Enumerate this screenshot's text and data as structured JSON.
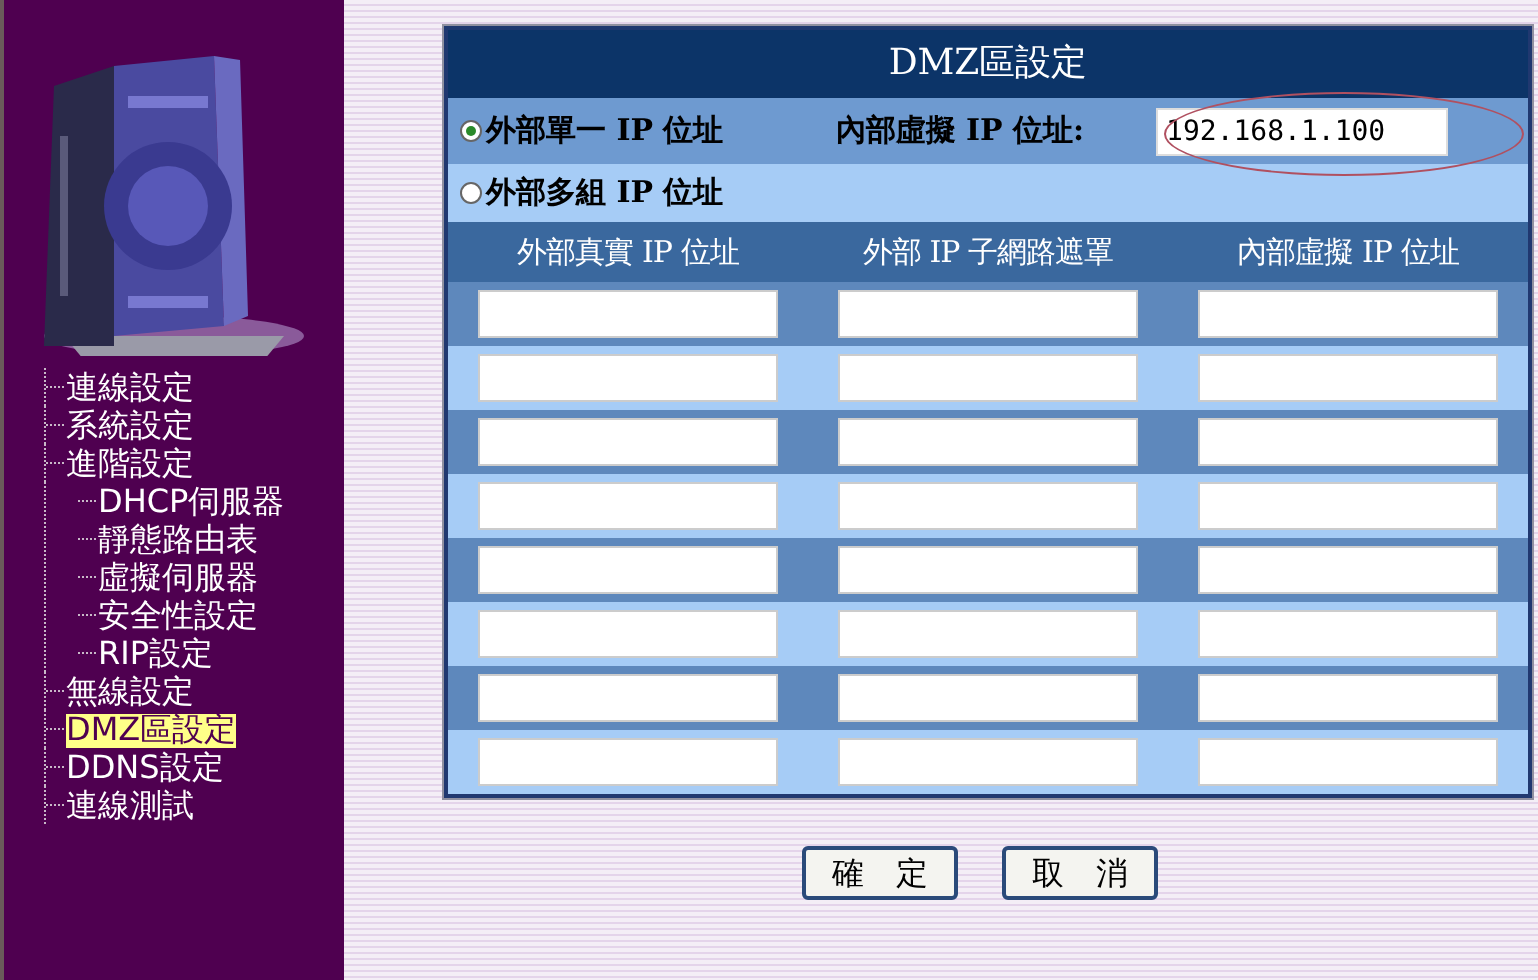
{
  "sidebar": {
    "items": [
      {
        "label": "連線設定",
        "selected": false
      },
      {
        "label": "系統設定",
        "selected": false
      },
      {
        "label": "進階設定",
        "selected": false,
        "children": [
          {
            "label": "DHCP伺服器",
            "selected": false
          },
          {
            "label": "靜態路由表",
            "selected": false
          },
          {
            "label": "虛擬伺服器",
            "selected": false
          },
          {
            "label": "安全性設定",
            "selected": false
          },
          {
            "label": "RIP設定",
            "selected": false
          }
        ]
      },
      {
        "label": "無線設定",
        "selected": false
      },
      {
        "label": "DMZ區設定",
        "selected": true
      },
      {
        "label": "DDNS設定",
        "selected": false
      },
      {
        "label": "連線測試",
        "selected": false
      }
    ]
  },
  "panel": {
    "title": "DMZ區設定",
    "modes": [
      {
        "label": "外部單一 IP 位址",
        "selected": true
      },
      {
        "label": "外部多組 IP 位址",
        "selected": false
      }
    ],
    "internal_ip": {
      "label": "內部虛擬 IP 位址:",
      "value": "192.168.1.100",
      "circled": true
    },
    "columns": [
      "外部真實 IP 位址",
      "外部 IP 子網路遮罩",
      "內部虛擬 IP 位址"
    ],
    "rows": [
      {
        "kind": "input-row"
      },
      {
        "kind": "input-row"
      },
      {
        "kind": "input-row"
      },
      {
        "kind": "input-row"
      },
      {
        "kind": "input-row"
      },
      {
        "kind": "input-row"
      },
      {
        "kind": "input-row"
      },
      {
        "kind": "input-row"
      }
    ]
  },
  "buttons": [
    "確　定",
    "取　消"
  ]
}
